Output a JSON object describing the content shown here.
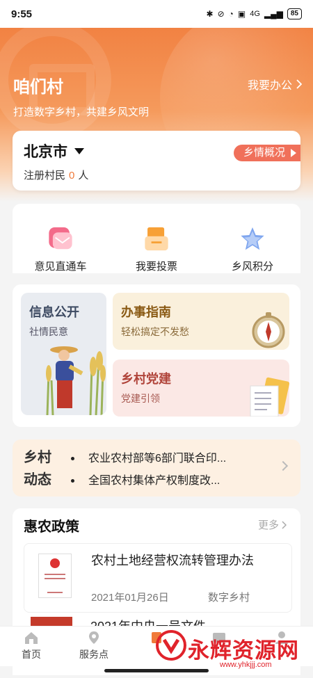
{
  "status_bar": {
    "time": "9:55",
    "network": "4G",
    "battery": "85"
  },
  "header": {
    "village_name": "咱们村",
    "slogan": "打造数字乡村，共建乡风文明",
    "office_link": "我要办公"
  },
  "city_card": {
    "city": "北京市",
    "residents_label": "注册村民",
    "residents_count": "0",
    "residents_unit": "人",
    "overview_button": "乡情概况"
  },
  "quick_actions": [
    {
      "label": "意见直通车",
      "icon": "mail-icon"
    },
    {
      "label": "我要投票",
      "icon": "ballot-icon"
    },
    {
      "label": "乡风积分",
      "icon": "star-icon"
    }
  ],
  "services": {
    "info": {
      "title": "信息公开",
      "subtitle": "社情民意"
    },
    "guide": {
      "title": "办事指南",
      "subtitle": "轻松搞定不发愁"
    },
    "party": {
      "title": "乡村党建",
      "subtitle": "党建引领"
    }
  },
  "news": {
    "title_line1": "乡村",
    "title_line2": "动态",
    "items": [
      "农业农村部等6部门联合印...",
      "全国农村集体产权制度改..."
    ]
  },
  "policy": {
    "title": "惠农政策",
    "more": "更多",
    "items": [
      {
        "name": "农村土地经营权流转管理办法",
        "date": "2021年01月26日",
        "source": "数字乡村"
      },
      {
        "name": "2021年中央一号文件"
      }
    ]
  },
  "tab_bar": [
    {
      "label": "首页",
      "icon": "home-icon"
    },
    {
      "label": "服务点",
      "icon": "location-icon"
    },
    {
      "label": "",
      "icon": "center-icon"
    },
    {
      "label": "",
      "icon": "message-icon"
    },
    {
      "label": "",
      "icon": "user-icon"
    }
  ],
  "watermark": {
    "text": "永辉资源网",
    "url": "www.yhkjjj.com"
  },
  "colors": {
    "accent": "#f07a3a",
    "badge": "#f0705a"
  }
}
